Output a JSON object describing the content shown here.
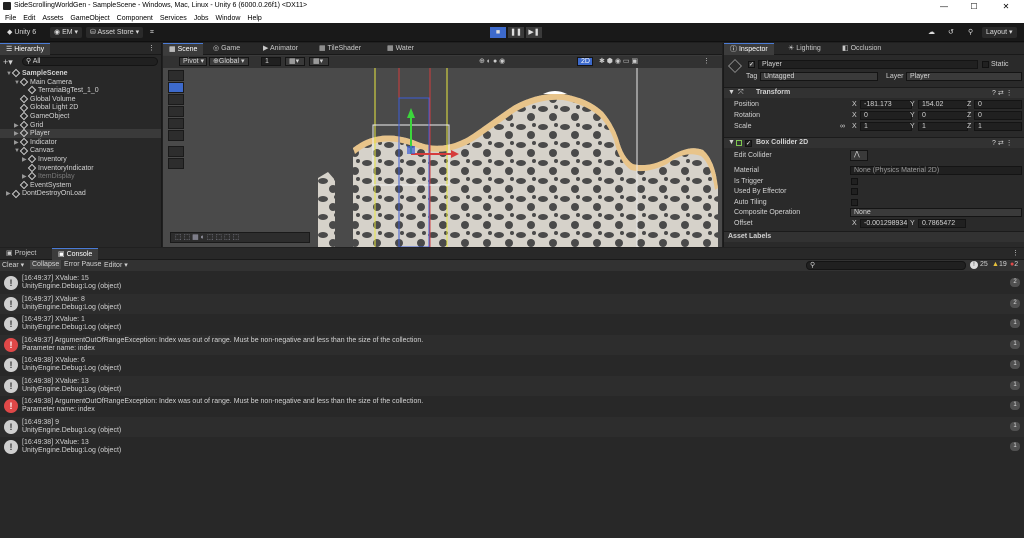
{
  "window": {
    "title": "SideScrollingWorldGen - SampleScene - Windows, Mac, Linux - Unity 6 (6000.0.26f1) <DX11>",
    "min": "—",
    "max": "☐",
    "close": "✕"
  },
  "menu": [
    "File",
    "Edit",
    "Assets",
    "GameObject",
    "Component",
    "Services",
    "Jobs",
    "Window",
    "Help"
  ],
  "toolbar": {
    "unity": "Unity 6",
    "account": "EM",
    "store": "Asset Store",
    "layout": "Layout"
  },
  "hierarchy": {
    "tab": "Hierarchy",
    "search_placeholder": "All",
    "items": [
      {
        "label": "SampleScene",
        "indent": 0,
        "arrow": "▼",
        "bold": true
      },
      {
        "label": "Main Camera",
        "indent": 1,
        "arrow": "▼"
      },
      {
        "label": "TerrariaBgTest_1_0",
        "indent": 2,
        "arrow": ""
      },
      {
        "label": "Global Volume",
        "indent": 1,
        "arrow": ""
      },
      {
        "label": "Global Light 2D",
        "indent": 1,
        "arrow": ""
      },
      {
        "label": "GameObject",
        "indent": 1,
        "arrow": ""
      },
      {
        "label": "Grid",
        "indent": 1,
        "arrow": "▶"
      },
      {
        "label": "Player",
        "indent": 1,
        "arrow": "▶",
        "selected": true
      },
      {
        "label": "Indicator",
        "indent": 1,
        "arrow": "▶"
      },
      {
        "label": "Canvas",
        "indent": 1,
        "arrow": "▼"
      },
      {
        "label": "Inventory",
        "indent": 2,
        "arrow": "▶"
      },
      {
        "label": "InventoryIndicator",
        "indent": 2,
        "arrow": ""
      },
      {
        "label": "ItemDisplay",
        "indent": 2,
        "arrow": "▶",
        "dim": true
      },
      {
        "label": "EventSystem",
        "indent": 1,
        "arrow": ""
      },
      {
        "label": "DontDestroyOnLoad",
        "indent": 0,
        "arrow": "▶"
      }
    ]
  },
  "center_tabs": [
    "Scene",
    "Game",
    "Animator",
    "TileShader",
    "Water"
  ],
  "scene_toolbar": {
    "pivot": "Pivot",
    "global": "Global",
    "grid_value": "1",
    "mode2d": "2D"
  },
  "inspector": {
    "tabs": [
      "Inspector",
      "Lighting",
      "Occlusion"
    ],
    "object_name": "Player",
    "static": "Static",
    "tag_label": "Tag",
    "tag_value": "Untagged",
    "layer_label": "Layer",
    "layer_value": "Player",
    "transform": {
      "title": "Transform",
      "position_label": "Position",
      "rotation_label": "Rotation",
      "scale_label": "Scale",
      "position": {
        "x": "-181.173",
        "y": "154.02",
        "z": "0"
      },
      "rotation": {
        "x": "0",
        "y": "0",
        "z": "0"
      },
      "scale": {
        "x": "1",
        "y": "1",
        "z": "1"
      }
    },
    "box_collider": {
      "title": "Box Collider 2D",
      "edit_collider": "Edit Collider",
      "material_label": "Material",
      "material_value": "None (Physics Material 2D)",
      "is_trigger": "Is Trigger",
      "used_by_effector": "Used By Effector",
      "auto_tiling": "Auto Tiling",
      "composite_label": "Composite Operation",
      "composite_value": "None",
      "offset_label": "Offset",
      "offset_x": "-0.001298934",
      "offset_y": "0.7865472"
    },
    "asset_labels": "Asset Labels"
  },
  "console": {
    "tabs": [
      "Project",
      "Console"
    ],
    "buttons": {
      "clear": "Clear",
      "collapse": "Collapse",
      "error_pause": "Error Pause",
      "editor": "Editor"
    },
    "counts": {
      "info": "25",
      "warn": "19",
      "error": "2"
    },
    "logs": [
      {
        "type": "info",
        "line1": "[16:49:37] XValue: 15",
        "line2": "UnityEngine.Debug:Log (object)",
        "count": "2"
      },
      {
        "type": "info",
        "line1": "[16:49:37] XValue: 8",
        "line2": "UnityEngine.Debug:Log (object)",
        "count": "2"
      },
      {
        "type": "info",
        "line1": "[16:49:37] XValue: 1",
        "line2": "UnityEngine.Debug:Log (object)",
        "count": "1"
      },
      {
        "type": "error",
        "line1": "[16:49:37] ArgumentOutOfRangeException: Index was out of range. Must be non-negative and less than the size of the collection.",
        "line2": "Parameter name: index",
        "count": "1"
      },
      {
        "type": "info",
        "line1": "[16:49:38] XValue: 6",
        "line2": "UnityEngine.Debug:Log (object)",
        "count": "1"
      },
      {
        "type": "info",
        "line1": "[16:49:38] XValue: 13",
        "line2": "UnityEngine.Debug:Log (object)",
        "count": "1"
      },
      {
        "type": "error",
        "line1": "[16:49:38] ArgumentOutOfRangeException: Index was out of range. Must be non-negative and less than the size of the collection.",
        "line2": "Parameter name: index",
        "count": "1"
      },
      {
        "type": "info",
        "line1": "[16:49:38] 9",
        "line2": "UnityEngine.Debug:Log (object)",
        "count": "1"
      },
      {
        "type": "info",
        "line1": "[16:49:38] XValue: 13",
        "line2": "UnityEngine.Debug:Log (object)",
        "count": "1"
      }
    ]
  },
  "colors": {
    "accent": "#4a7bd6",
    "error": "#e04848",
    "sand": "#e8c48a",
    "rock": "#d8d4cc",
    "dark": "#4b4b4b"
  }
}
